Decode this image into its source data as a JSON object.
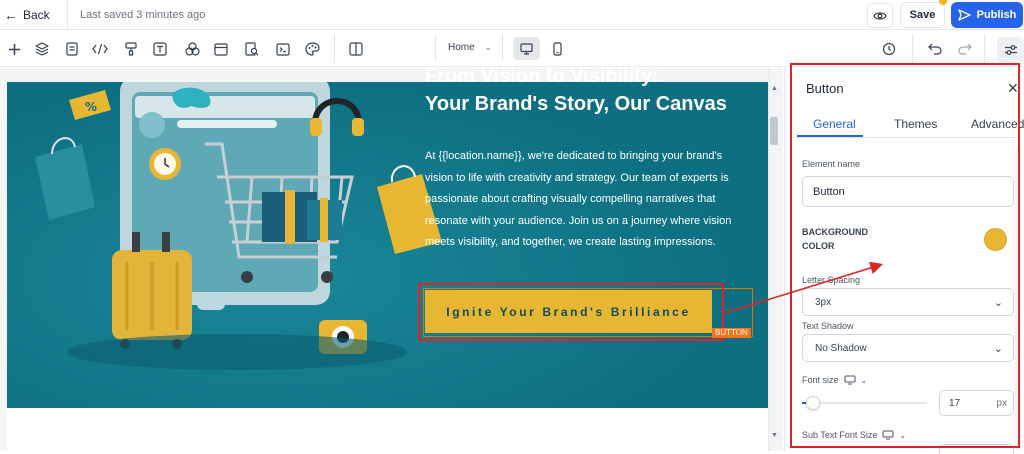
{
  "topbar": {
    "back_label": "Back",
    "saved_text": "Last saved 3 minutes ago",
    "save_label": "Save",
    "publish_label": "Publish"
  },
  "toolbar": {
    "page_select": "Home",
    "icons": [
      "plus-icon",
      "layers-icon",
      "form-icon",
      "code-icon",
      "paint-icon",
      "text-icon",
      "shapes-icon",
      "window-icon",
      "search-doc-icon",
      "terminal-icon",
      "palette-icon",
      "columns-icon"
    ]
  },
  "hero": {
    "heading_line1": "From Vision to Visibility:",
    "heading_line2": "Your Brand's Story, Our Canvas",
    "body": "At {{location.name}}, we're dedicated to bringing your brand's vision to life with creativity and strategy. Our team of experts is passionate about crafting visually compelling narratives that resonate with your audience. Join us on a journey where vision meets visibility, and together, we create lasting impressions.",
    "cta_label": "Ignite Your Brand's Brilliance",
    "cta_tag": "BUTTON"
  },
  "panel": {
    "title": "Button",
    "tabs": [
      {
        "label": "General",
        "active": true
      },
      {
        "label": "Themes",
        "active": false
      },
      {
        "label": "Advanced",
        "active": false
      }
    ],
    "element_name_label": "Element name",
    "element_name_value": "Button",
    "background_color_label": "BACKGROUND COLOR",
    "background_color_value": "#e7b733",
    "letter_spacing_label": "Letter Spacing",
    "letter_spacing_value": "3px",
    "text_shadow_label": "Text Shadow",
    "text_shadow_value": "No Shadow",
    "font_size_label": "Font size",
    "font_size_value": "17",
    "font_size_unit": "px",
    "font_size_slider_fraction": 0.08,
    "sub_text_font_size_label": "Sub Text Font Size"
  },
  "colors": {
    "accent": "#2563eb",
    "hero_bg": "#0e6f82",
    "cta_bg": "#e7b733",
    "highlight": "#dc2626"
  }
}
